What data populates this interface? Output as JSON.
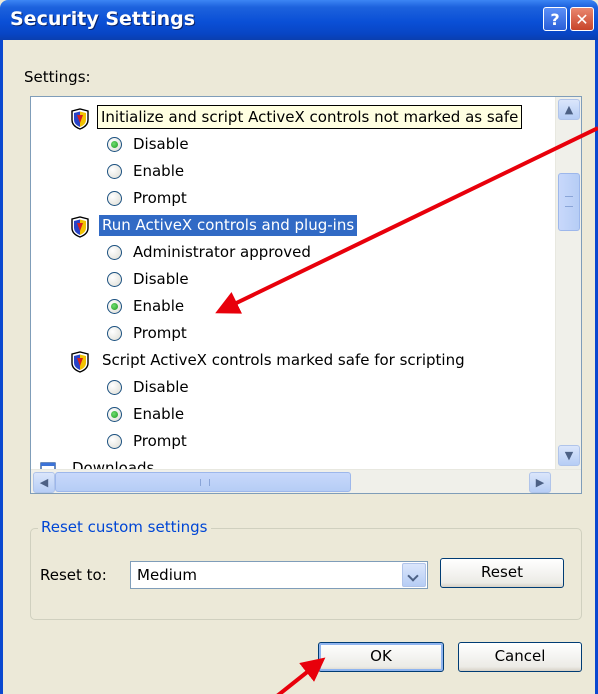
{
  "window": {
    "title": "Security Settings",
    "help_label": "?",
    "close_label": "✕"
  },
  "settings_label": "Settings:",
  "settings_list": {
    "categories": [
      {
        "label": "Initialize and script ActiveX controls not marked as safe",
        "icon": "security-shield-icon",
        "options": [
          {
            "label": "Disable",
            "selected": true
          },
          {
            "label": "Enable",
            "selected": false
          },
          {
            "label": "Prompt",
            "selected": false
          }
        ]
      },
      {
        "label": "Run ActiveX controls and plug-ins",
        "icon": "security-shield-icon",
        "options": [
          {
            "label": "Administrator approved",
            "selected": false
          },
          {
            "label": "Disable",
            "selected": false
          },
          {
            "label": "Enable",
            "selected": true
          },
          {
            "label": "Prompt",
            "selected": false
          }
        ]
      },
      {
        "label": "Script ActiveX controls marked safe for scripting",
        "icon": "security-shield-icon",
        "options": [
          {
            "label": "Disable",
            "selected": false
          },
          {
            "label": "Enable",
            "selected": true
          },
          {
            "label": "Prompt",
            "selected": false
          }
        ]
      },
      {
        "label": "Downloads",
        "icon": "downloads-icon"
      }
    ]
  },
  "reset_group": {
    "title": "Reset custom settings",
    "reset_to_label": "Reset to:",
    "selected_level": "Medium",
    "reset_button": "Reset"
  },
  "buttons": {
    "ok": "OK",
    "cancel": "Cancel"
  },
  "colors": {
    "titlebar": "#0a4fd6",
    "selection": "#316ac5",
    "annotation_arrow": "#e8000b",
    "group_title": "#0046d5"
  }
}
